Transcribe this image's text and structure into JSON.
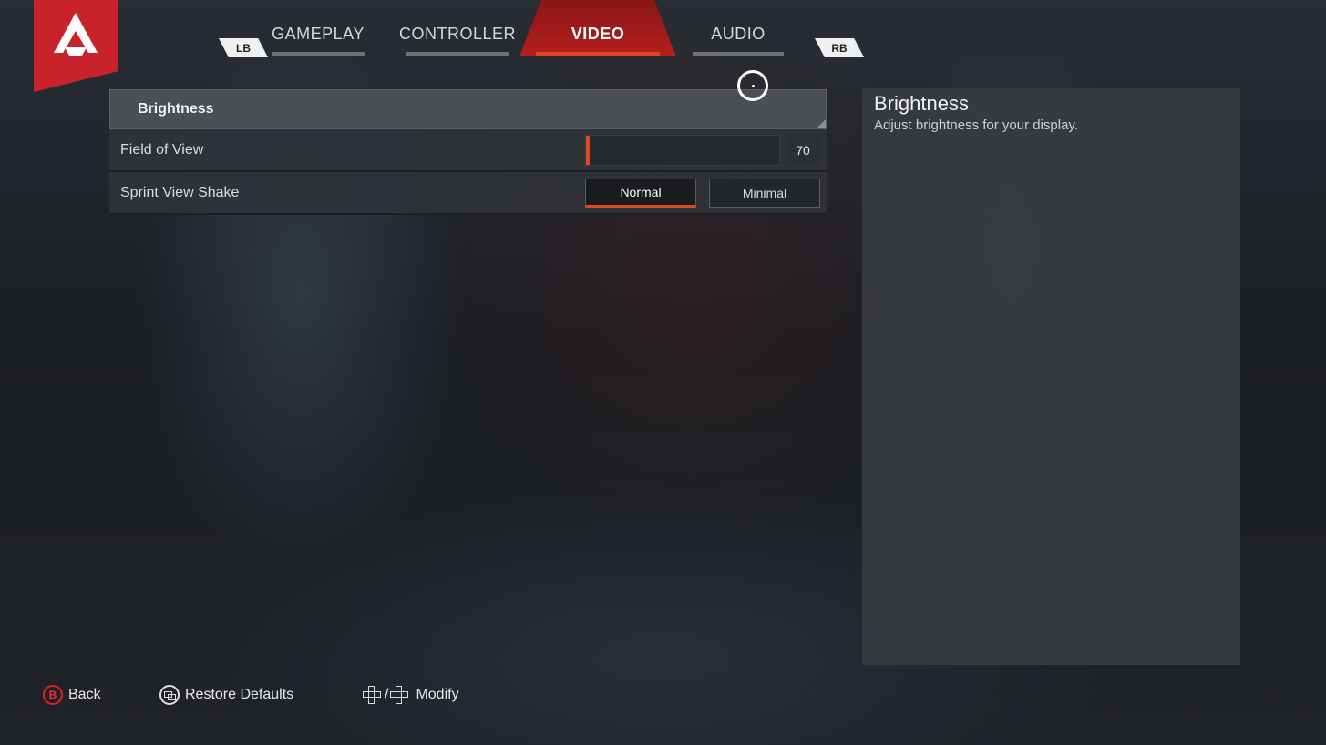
{
  "tabs": {
    "left_bumper": "LB",
    "right_bumper": "RB",
    "items": [
      {
        "label": "GAMEPLAY"
      },
      {
        "label": "CONTROLLER"
      },
      {
        "label": "VIDEO",
        "active": true
      },
      {
        "label": "AUDIO"
      }
    ]
  },
  "settings": {
    "brightness": {
      "label": "Brightness"
    },
    "fov": {
      "label": "Field of View",
      "value": "70"
    },
    "sprint_shake": {
      "label": "Sprint View Shake",
      "options": [
        "Normal",
        "Minimal"
      ],
      "selected": "Normal"
    }
  },
  "description": {
    "title": "Brightness",
    "text": "Adjust brightness for your display."
  },
  "footer": {
    "back_button_glyph": "B",
    "back": "Back",
    "restore": "Restore Defaults",
    "modify": "Modify",
    "modify_separator": "/"
  },
  "colors": {
    "accent": "#e0471e",
    "tab_active": "#b51e1e",
    "logo": "#c8222a"
  }
}
